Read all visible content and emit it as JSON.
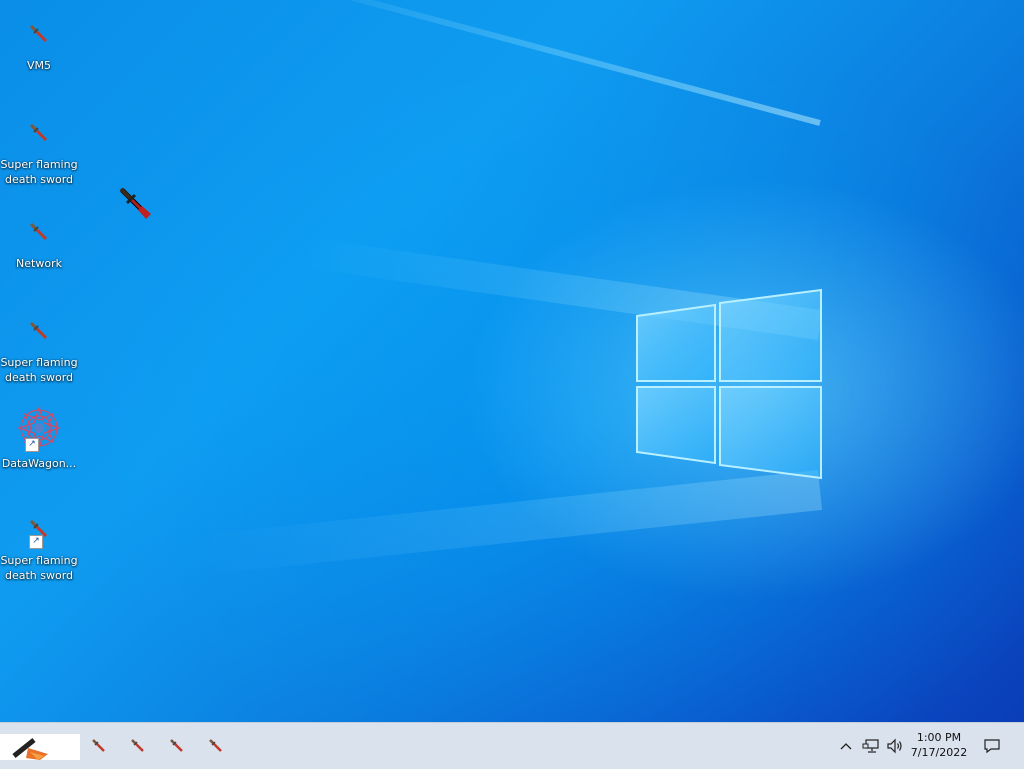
{
  "desktop": {
    "icons": [
      {
        "label": "VM5",
        "shortcut": false,
        "icon": "sword-icon"
      },
      {
        "label": "Super flaming death sword",
        "shortcut": false,
        "icon": "sword-icon"
      },
      {
        "label": "Network",
        "shortcut": false,
        "icon": "sword-icon"
      },
      {
        "label": "Super flaming death sword",
        "shortcut": false,
        "icon": "sword-icon"
      },
      {
        "label": "DataWagon...",
        "shortcut": true,
        "icon": "datawagon-icon"
      },
      {
        "label": "Super flaming death sword",
        "shortcut": true,
        "icon": "sword-icon"
      }
    ],
    "colors": {
      "accent": "#0a8ee8",
      "sword_blade": "#c0392b",
      "sword_hilt": "#7a5a3a"
    }
  },
  "taskbar": {
    "pinned_apps": [
      "sword-icon",
      "sword-icon",
      "sword-icon",
      "sword-icon"
    ],
    "tray": {
      "chevron_icon": "^",
      "time": "1:00 PM",
      "date": "7/17/2022"
    }
  }
}
